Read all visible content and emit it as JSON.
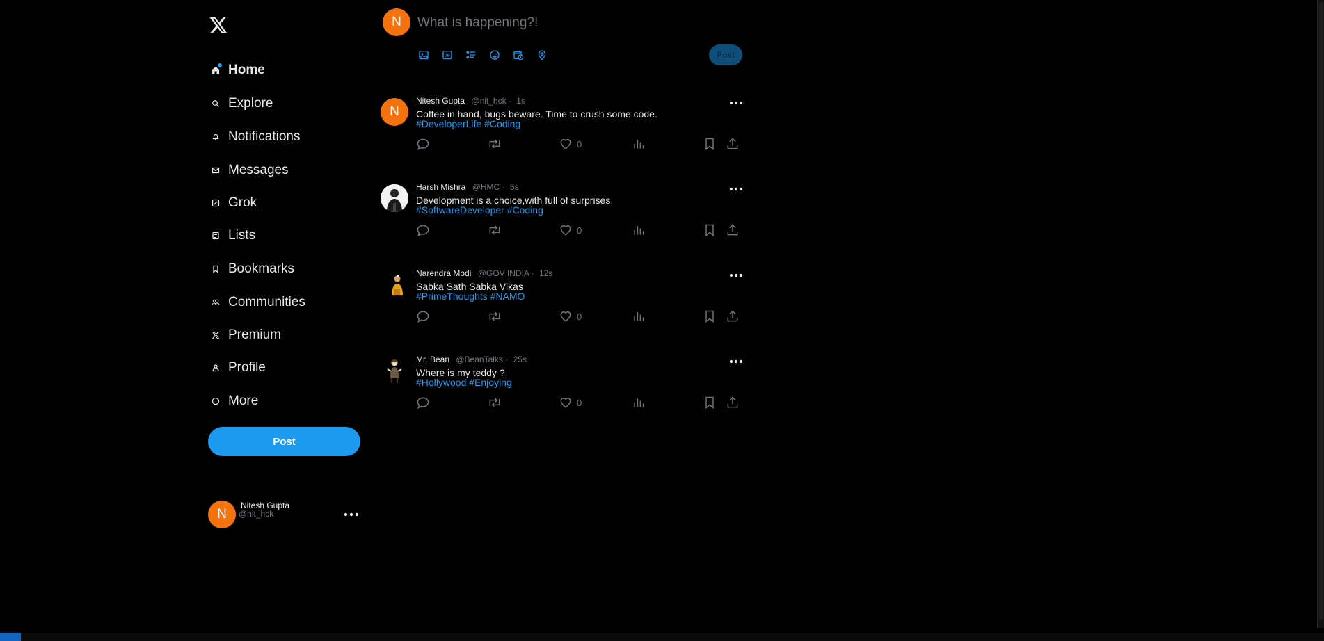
{
  "sidebar": {
    "logo": "x-logo",
    "nav": [
      {
        "label": "Home",
        "icon": "home-icon",
        "active": true
      },
      {
        "label": "Explore",
        "icon": "search-icon"
      },
      {
        "label": "Notifications",
        "icon": "bell-icon"
      },
      {
        "label": "Messages",
        "icon": "mail-icon"
      },
      {
        "label": "Grok",
        "icon": "grok-icon"
      },
      {
        "label": "Lists",
        "icon": "list-icon"
      },
      {
        "label": "Bookmarks",
        "icon": "bookmark-icon"
      },
      {
        "label": "Communities",
        "icon": "communities-icon"
      },
      {
        "label": "Premium",
        "icon": "x-icon"
      },
      {
        "label": "Profile",
        "icon": "profile-icon"
      },
      {
        "label": "More",
        "icon": "more-circle-icon"
      }
    ],
    "post_label": "Post",
    "account": {
      "avatar_letter": "N",
      "name": "Nitesh Gupta",
      "handle": "@nit_hck"
    }
  },
  "compose": {
    "avatar_letter": "N",
    "placeholder": "What is happening?!",
    "tools": [
      "image-icon",
      "gif-icon",
      "poll-icon",
      "emoji-icon",
      "schedule-icon",
      "location-icon"
    ],
    "post_label": "Post"
  },
  "tweets": [
    {
      "name": "Nitesh Gupta",
      "handle": "@nit_hck",
      "sep": "·",
      "time": "1s",
      "text": "Coffee in hand, bugs beware. Time to crush some code.",
      "tags": [
        "#DeveloperLife",
        "#Coding"
      ],
      "likes": "0",
      "avatar": "orange-letter",
      "avatar_letter": "N"
    },
    {
      "name": "Harsh Mishra",
      "handle": "@HMC",
      "sep": "·",
      "time": "5s",
      "text": "Development is a choice,with full of surprises.",
      "tags": [
        "#SoftwareDeveloper",
        "#Coding"
      ],
      "likes": "0",
      "avatar": "photo-person-white-bg"
    },
    {
      "name": "Narendra Modi",
      "handle": "@GOV INDIA",
      "sep": "·",
      "time": "12s",
      "text": "Sabka Sath Sabka Vikas",
      "tags": [
        "#PrimeThoughts",
        "#NAMO"
      ],
      "likes": "0",
      "avatar": "photo-person-saffron"
    },
    {
      "name": "Mr. Bean",
      "handle": "@BeanTalks",
      "sep": "·",
      "time": "25s",
      "text": "Where is my teddy ?",
      "tags": [
        "#Hollywood",
        "#Enjoying"
      ],
      "likes": "0",
      "avatar": "photo-person-cartoon"
    }
  ],
  "colors": {
    "accent": "#1d9bf0",
    "avatar_orange": "#f4730f",
    "muted": "#71767b",
    "text": "#e7e9ea",
    "background": "#000000"
  }
}
